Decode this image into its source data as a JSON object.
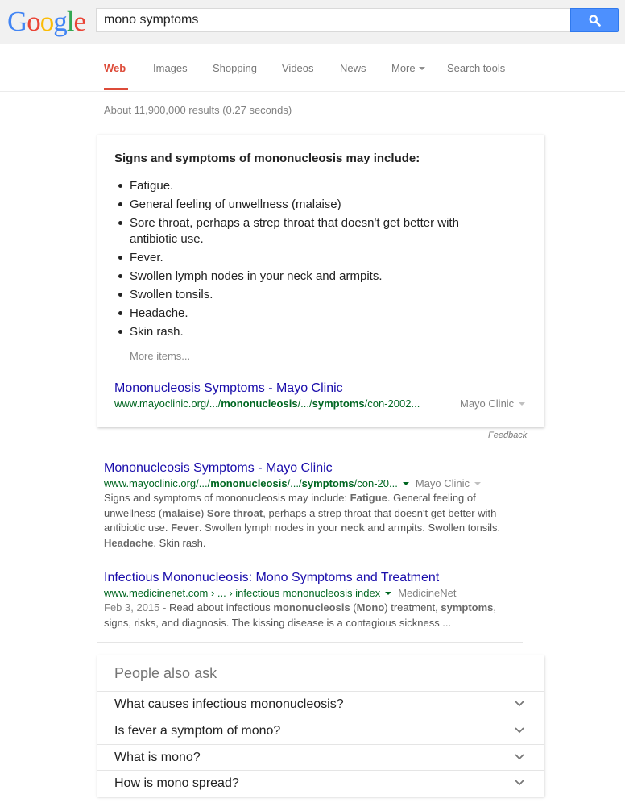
{
  "logo": [
    "G",
    "o",
    "o",
    "g",
    "l",
    "e"
  ],
  "logo_colors": [
    "#4285f4",
    "#ea4335",
    "#fbbc05",
    "#4285f4",
    "#34a853",
    "#ea4335"
  ],
  "search": {
    "value": "mono symptoms"
  },
  "tabs": [
    {
      "label": "Web"
    },
    {
      "label": "Images"
    },
    {
      "label": "Shopping"
    },
    {
      "label": "Videos"
    },
    {
      "label": "News"
    },
    {
      "label": "More"
    },
    {
      "label": "Search tools"
    }
  ],
  "results_stats": "About 11,900,000 results (0.27 seconds)",
  "snippet": {
    "heading": "Signs and symptoms of mononucleosis may include:",
    "items": [
      "Fatigue.",
      "General feeling of unwellness (malaise)",
      "Sore throat, perhaps a strep throat that doesn't get better with antibiotic use.",
      "Fever.",
      "Swollen lymph nodes in your neck and armpits.",
      "Swollen tonsils.",
      "Headache.",
      "Skin rash."
    ],
    "more_items": "More items...",
    "link_title": "Mononucleosis Symptoms - Mayo Clinic",
    "url_parts": [
      "www.mayoclinic.org/.../",
      "mononucleosis",
      "/.../",
      "symptoms",
      "/con-2002..."
    ],
    "source": "Mayo Clinic"
  },
  "feedback": "Feedback",
  "results": [
    {
      "title": "Mononucleosis Symptoms - Mayo Clinic",
      "url_parts": [
        "www.mayoclinic.org/.../",
        "mononucleosis",
        "/.../",
        "symptoms",
        "/con-20..."
      ],
      "source": "Mayo Clinic",
      "desc": [
        {
          "t": "Signs and symptoms of mononucleosis may include: ",
          "b": false
        },
        {
          "t": "Fatigue",
          "b": true
        },
        {
          "t": ". General feeling of unwellness (",
          "b": false
        },
        {
          "t": "malaise",
          "b": true
        },
        {
          "t": ") ",
          "b": false
        },
        {
          "t": "Sore throat",
          "b": true
        },
        {
          "t": ", perhaps a strep throat that doesn't get better with antibiotic use. ",
          "b": false
        },
        {
          "t": "Fever",
          "b": true
        },
        {
          "t": ". Swollen lymph nodes in your ",
          "b": false
        },
        {
          "t": "neck",
          "b": true
        },
        {
          "t": " and armpits. Swollen tonsils. ",
          "b": false
        },
        {
          "t": "Headache",
          "b": true
        },
        {
          "t": ". Skin rash.",
          "b": false
        }
      ]
    },
    {
      "title": "Infectious Mononucleosis: Mono Symptoms and Treatment",
      "url_text": "www.medicinenet.com › ... › infectious mononucleosis index",
      "source": "MedicineNet",
      "date": "Feb 3, 2015 - ",
      "desc": [
        {
          "t": "Read about infectious ",
          "b": false
        },
        {
          "t": "mononucleosis",
          "b": true
        },
        {
          "t": " (",
          "b": false
        },
        {
          "t": "Mono",
          "b": true
        },
        {
          "t": ") treatment, ",
          "b": false
        },
        {
          "t": "symptoms",
          "b": true
        },
        {
          "t": ", signs, risks, and diagnosis. The kissing disease is a contagious sickness ...",
          "b": false
        }
      ]
    }
  ],
  "people_also_ask": {
    "heading": "People also ask",
    "questions": [
      "What causes infectious mononucleosis?",
      "Is fever a symptom of mono?",
      "What is mono?",
      "How is mono spread?"
    ]
  },
  "icons": {
    "search_button": "magnifier-icon",
    "expand": "chevron-down-icon"
  }
}
